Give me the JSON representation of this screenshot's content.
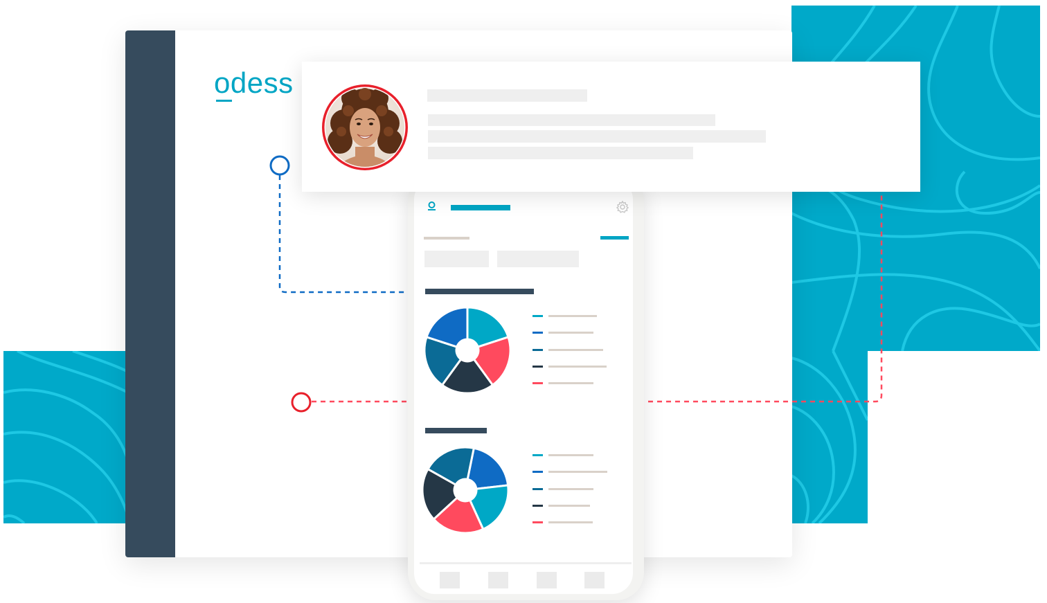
{
  "app": {
    "logo_text": "odess"
  },
  "colors": {
    "teal": "#00a5c4",
    "topo_bg": "#00a9c9",
    "topo_line": "#1ec8e4",
    "navy": "#364b5d",
    "dark_navy": "#253746",
    "blue": "#0f6bc4",
    "ocean": "#0b6b96",
    "coral": "#ff4a5e",
    "red_ring": "#e8202b",
    "skeleton": "#efefef",
    "legend_line": "#d9d1c9"
  },
  "profile_card": {
    "avatar": "woman-smiling-portrait"
  },
  "phone": {
    "icons": [
      "odessa-o-icon",
      "gear-icon"
    ],
    "charts": [
      {
        "name": "donut-chart-1",
        "colors": [
          "#00a8c6",
          "#ff4a5e",
          "#253746",
          "#0b6b96",
          "#0f6bc4"
        ]
      },
      {
        "name": "donut-chart-2",
        "colors": [
          "#0f6bc4",
          "#00a8c6",
          "#ff4a5e",
          "#253746",
          "#0b6b96"
        ]
      }
    ],
    "legend_colors": [
      "#00a8c6",
      "#0f6bc4",
      "#0b6b96",
      "#253746",
      "#ff4a5e"
    ]
  }
}
